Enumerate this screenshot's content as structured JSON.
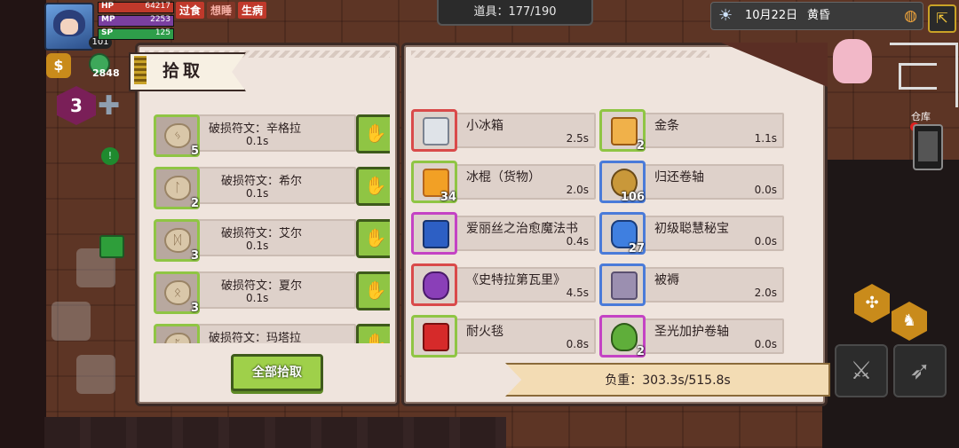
{
  "hud": {
    "hp_label": "HP",
    "hp_value": "64217",
    "mp_label": "MP",
    "mp_value": "2253",
    "sp_label": "SP",
    "sp_value": "125",
    "level": "101",
    "status_tags": [
      "过食",
      "想睡",
      "生病"
    ],
    "item_capacity": "道具：177/190",
    "date": "10月22日",
    "time_of_day": "黄昏",
    "gem_count": "2848",
    "skill_level": "3",
    "storage_label": "仓库"
  },
  "left_panel": {
    "title": "拾取",
    "items": [
      {
        "name": "破损符文：辛格拉",
        "weight": "0.1s",
        "qty": "5",
        "icon": "rune-icon"
      },
      {
        "name": "破损符文：希尔",
        "weight": "0.1s",
        "qty": "2",
        "icon": "rune-icon"
      },
      {
        "name": "破损符文：艾尔",
        "weight": "0.1s",
        "qty": "3",
        "icon": "rune-icon"
      },
      {
        "name": "破损符文：夏尔",
        "weight": "0.1s",
        "qty": "3",
        "icon": "rune-icon"
      },
      {
        "name": "破损符文：玛塔拉",
        "weight": "",
        "qty": "",
        "icon": "rune-icon"
      }
    ],
    "pick_all_label": "全部拾取"
  },
  "right_panel": {
    "items": [
      {
        "name": "小冰箱",
        "weight": "2.5s",
        "qty": "",
        "border": "red"
      },
      {
        "name": "金条",
        "weight": "1.1s",
        "qty": "2",
        "border": "green"
      },
      {
        "name": "冰棍（货物）",
        "weight": "2.0s",
        "qty": "34",
        "border": "green"
      },
      {
        "name": "归还卷轴",
        "weight": "0.0s",
        "qty": "106",
        "border": "blue"
      },
      {
        "name": "爱丽丝之治愈魔法书",
        "weight": "0.4s",
        "qty": "",
        "border": "purple"
      },
      {
        "name": "初级聪慧秘宝",
        "weight": "0.0s",
        "qty": "27",
        "border": "blue"
      },
      {
        "name": "《史特拉第瓦里》",
        "weight": "4.5s",
        "qty": "",
        "border": "red"
      },
      {
        "name": "被褥",
        "weight": "2.0s",
        "qty": "",
        "border": "blue"
      },
      {
        "name": "耐火毯",
        "weight": "0.8s",
        "qty": "",
        "border": "green"
      },
      {
        "name": "圣光加护卷轴",
        "weight": "0.0s",
        "qty": "2",
        "border": "purple"
      }
    ],
    "weight_label": "负重：303.3s/515.8s"
  },
  "colors": {
    "panel_bg": "#efe4dd",
    "slot_green": "#8fc544",
    "slot_red": "#d94a4a",
    "slot_purple": "#c443c4",
    "slot_blue": "#4a7bd9"
  }
}
